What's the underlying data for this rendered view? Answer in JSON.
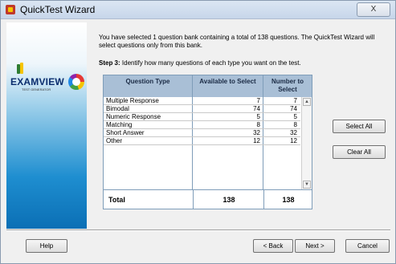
{
  "window": {
    "title": "QuickTest Wizard",
    "close_label": "X"
  },
  "logo": {
    "brand": "EXAMVIEW",
    "sub": "TEST GENERATOR"
  },
  "intro_text": "You have selected 1 question bank containing a total of 138 questions.  The QuickTest Wizard will select questions only from this bank.",
  "step": {
    "label": "Step 3:",
    "text": "Identify how many questions of each type you want on the test."
  },
  "table": {
    "headers": {
      "type": "Question Type",
      "available": "Available to Select",
      "select": "Number to Select"
    },
    "rows": [
      {
        "type": "Multiple Response",
        "available": "7",
        "select": "7"
      },
      {
        "type": "Bimodal",
        "available": "74",
        "select": "74"
      },
      {
        "type": "Numeric Response",
        "available": "5",
        "select": "5"
      },
      {
        "type": "Matching",
        "available": "8",
        "select": "8"
      },
      {
        "type": "Short Answer",
        "available": "32",
        "select": "32"
      },
      {
        "type": "Other",
        "available": "12",
        "select": "12"
      }
    ],
    "total": {
      "label": "Total",
      "available": "138",
      "select": "138"
    }
  },
  "buttons": {
    "select_all": "Select All",
    "clear_all": "Clear All",
    "help": "Help",
    "back": "< Back",
    "next": "Next >",
    "cancel": "Cancel"
  },
  "colors": {
    "header_bg": "#a9bfd6",
    "sidebar_blue": "#1e8ed0",
    "grid_border": "#7f9db9"
  }
}
